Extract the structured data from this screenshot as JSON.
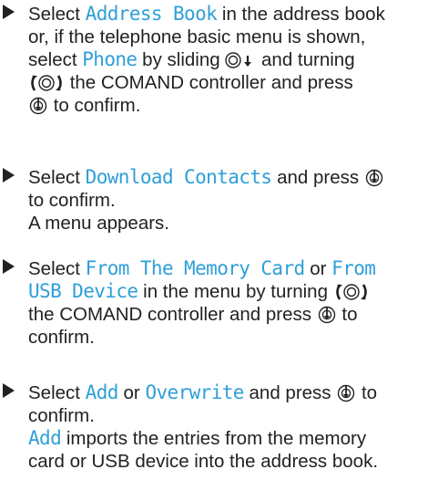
{
  "steps": [
    {
      "lines": [
        [
          {
            "t": "Select "
          },
          {
            "ui": "Address Book"
          },
          {
            "t": " in the address book"
          }
        ],
        [
          {
            "t": "or, if the telephone basic menu is shown,"
          }
        ],
        [
          {
            "t": "select "
          },
          {
            "ui": "Phone"
          },
          {
            "t": " by sliding "
          },
          {
            "icon": "slide-down-controller-icon"
          },
          {
            "t": " and turning"
          }
        ],
        [
          {
            "icon": "turn-controller-icon"
          },
          {
            "t": " the COMAND controller and press"
          }
        ],
        [
          {
            "icon": "press-controller-icon"
          },
          {
            "t": " to confirm."
          }
        ]
      ]
    },
    {
      "lines": [
        [
          {
            "t": "Select "
          },
          {
            "ui": "Download Contacts"
          },
          {
            "t": " and press "
          },
          {
            "icon": "press-controller-icon"
          }
        ],
        [
          {
            "t": "to confirm."
          }
        ],
        [
          {
            "t": "A menu appears."
          }
        ]
      ]
    },
    {
      "lines": [
        [
          {
            "t": "Select "
          },
          {
            "ui": "From The Memory Card"
          },
          {
            "t": " or "
          },
          {
            "ui": "From"
          }
        ],
        [
          {
            "ui": "USB Device"
          },
          {
            "t": " in the menu by turning "
          },
          {
            "icon": "turn-controller-icon"
          }
        ],
        [
          {
            "t": "the COMAND controller and press "
          },
          {
            "icon": "press-controller-icon"
          },
          {
            "t": " to"
          }
        ],
        [
          {
            "t": "confirm."
          }
        ]
      ]
    },
    {
      "lines": [
        [
          {
            "t": "Select "
          },
          {
            "ui": "Add"
          },
          {
            "t": " or "
          },
          {
            "ui": "Overwrite"
          },
          {
            "t": " and press "
          },
          {
            "icon": "press-controller-icon"
          },
          {
            "t": " to"
          }
        ],
        [
          {
            "t": "confirm."
          }
        ],
        [
          {
            "ui": "Add"
          },
          {
            "t": " imports the entries from the memory"
          }
        ],
        [
          {
            "t": "card or USB device into the address book."
          }
        ]
      ]
    }
  ],
  "colors": {
    "ui_term": "#2f9fd8",
    "text": "#222222"
  }
}
